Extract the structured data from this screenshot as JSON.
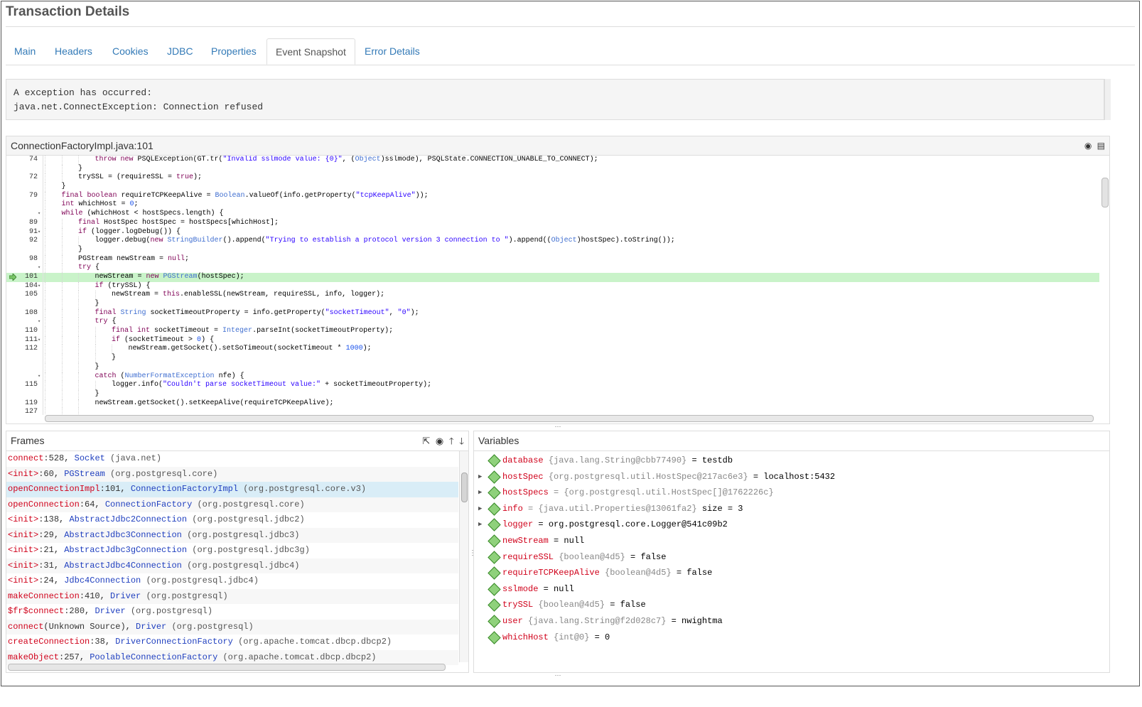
{
  "window_title": "Transaction Details",
  "tabs": [
    {
      "label": "Main"
    },
    {
      "label": "Headers"
    },
    {
      "label": "Cookies"
    },
    {
      "label": "JDBC"
    },
    {
      "label": "Properties"
    },
    {
      "label": "Event Snapshot"
    },
    {
      "label": "Error Details"
    }
  ],
  "active_tab": "Event Snapshot",
  "exception": {
    "line1": "A exception has occurred:",
    "line2": "java.net.ConnectException: Connection refused"
  },
  "code_panel": {
    "title": "ConnectionFactoryImpl.java:101",
    "lines": [
      {
        "ln": "74",
        "fold": "",
        "indent": 3,
        "html": "<span class=\"kw\">throw new</span> PSQLException(GT.tr(<span class=\"str\">\"Invalid sslmode value: {0}\"</span>, (<span class=\"typ\">Object</span>)sslmode), PSQLState.CONNECTION_UNABLE_TO_CONNECT);"
      },
      {
        "ln": "",
        "fold": "",
        "indent": 2,
        "html": "}"
      },
      {
        "ln": "72",
        "fold": "",
        "indent": 2,
        "html": "trySSL = (requireSSL = <span class=\"kw\">true</span>);"
      },
      {
        "ln": "",
        "fold": "",
        "indent": 1,
        "html": "}"
      },
      {
        "ln": "79",
        "fold": "",
        "indent": 1,
        "html": "<span class=\"kw\">final boolean</span> requireTCPKeepAlive = <span class=\"typ\">Boolean</span>.valueOf(info.getProperty(<span class=\"str\">\"tcpKeepAlive\"</span>));"
      },
      {
        "ln": "",
        "fold": "",
        "indent": 1,
        "html": "<span class=\"kw\">int</span> whichHost = <span class=\"num\">0</span>;"
      },
      {
        "ln": "",
        "fold": "▾",
        "indent": 1,
        "html": "<span class=\"kw\">while</span> (whichHost &lt; hostSpecs.length) {"
      },
      {
        "ln": "89",
        "fold": "",
        "indent": 2,
        "html": "<span class=\"kw\">final</span> HostSpec hostSpec = hostSpecs[whichHost];"
      },
      {
        "ln": "91",
        "fold": "▾",
        "indent": 2,
        "html": "<span class=\"kw\">if</span> (logger.logDebug()) {"
      },
      {
        "ln": "92",
        "fold": "",
        "indent": 3,
        "html": "logger.debug(<span class=\"kw\">new</span> <span class=\"typ\">StringBuilder</span>().append(<span class=\"str\">\"Trying to establish a protocol version 3 connection to \"</span>).append((<span class=\"typ\">Object</span>)hostSpec).toString());"
      },
      {
        "ln": "",
        "fold": "",
        "indent": 2,
        "html": "}"
      },
      {
        "ln": "98",
        "fold": "",
        "indent": 2,
        "html": "PGStream newStream = <span class=\"kw\">null</span>;"
      },
      {
        "ln": "",
        "fold": "▾",
        "indent": 2,
        "html": "<span class=\"kw\">try</span> {"
      },
      {
        "ln": "101",
        "fold": "",
        "indent": 3,
        "cur": true,
        "html": "newStream = <span class=\"kw\">new</span> <span class=\"typ\">PGStream</span>(hostSpec);"
      },
      {
        "ln": "104",
        "fold": "▾",
        "indent": 3,
        "html": "<span class=\"kw\">if</span> (trySSL) {"
      },
      {
        "ln": "105",
        "fold": "",
        "indent": 4,
        "html": "newStream = <span class=\"kw\">this</span>.enableSSL(newStream, requireSSL, info, logger);"
      },
      {
        "ln": "",
        "fold": "",
        "indent": 3,
        "html": "}"
      },
      {
        "ln": "108",
        "fold": "",
        "indent": 3,
        "html": "<span class=\"kw\">final</span> <span class=\"typ\">String</span> socketTimeoutProperty = info.getProperty(<span class=\"str\">\"socketTimeout\"</span>, <span class=\"str\">\"0\"</span>);"
      },
      {
        "ln": "",
        "fold": "▾",
        "indent": 3,
        "html": "<span class=\"kw\">try</span> {"
      },
      {
        "ln": "110",
        "fold": "",
        "indent": 4,
        "html": "<span class=\"kw\">final int</span> socketTimeout = <span class=\"typ\">Integer</span>.parseInt(socketTimeoutProperty);"
      },
      {
        "ln": "111",
        "fold": "▾",
        "indent": 4,
        "html": "<span class=\"kw\">if</span> (socketTimeout &gt; <span class=\"num\">0</span>) {"
      },
      {
        "ln": "112",
        "fold": "",
        "indent": 5,
        "html": "newStream.getSocket().setSoTimeout(socketTimeout * <span class=\"num\">1000</span>);"
      },
      {
        "ln": "",
        "fold": "",
        "indent": 4,
        "html": "}"
      },
      {
        "ln": "",
        "fold": "",
        "indent": 3,
        "html": "}"
      },
      {
        "ln": "",
        "fold": "▾",
        "indent": 3,
        "html": "<span class=\"kw\">catch</span> (<span class=\"typ\">NumberFormatException</span> nfe) {"
      },
      {
        "ln": "115",
        "fold": "",
        "indent": 4,
        "html": "logger.info(<span class=\"str\">\"Couldn't parse socketTimeout value:\"</span> + socketTimeoutProperty);"
      },
      {
        "ln": "",
        "fold": "",
        "indent": 3,
        "html": "}"
      },
      {
        "ln": "119",
        "fold": "",
        "indent": 3,
        "html": "newStream.getSocket().setKeepAlive(requireTCPKeepAlive);"
      },
      {
        "ln": "127",
        "fold": "",
        "indent": 3,
        "html": ""
      }
    ]
  },
  "frames_panel": {
    "title": "Frames",
    "rows": [
      {
        "method": "connect",
        "line": ":528, ",
        "cls": "Socket",
        "pkg": " (java.net)"
      },
      {
        "method": "<init>",
        "line": ":60, ",
        "cls": "PGStream",
        "pkg": " (org.postgresql.core)"
      },
      {
        "method": "openConnectionImpl",
        "line": ":101, ",
        "cls": "ConnectionFactoryImpl",
        "pkg": " (org.postgresql.core.v3)",
        "selected": true
      },
      {
        "method": "openConnection",
        "line": ":64, ",
        "cls": "ConnectionFactory",
        "pkg": " (org.postgresql.core)"
      },
      {
        "method": "<init>",
        "line": ":138, ",
        "cls": "AbstractJdbc2Connection",
        "pkg": " (org.postgresql.jdbc2)"
      },
      {
        "method": "<init>",
        "line": ":29, ",
        "cls": "AbstractJdbc3Connection",
        "pkg": " (org.postgresql.jdbc3)"
      },
      {
        "method": "<init>",
        "line": ":21, ",
        "cls": "AbstractJdbc3gConnection",
        "pkg": " (org.postgresql.jdbc3g)"
      },
      {
        "method": "<init>",
        "line": ":31, ",
        "cls": "AbstractJdbc4Connection",
        "pkg": " (org.postgresql.jdbc4)"
      },
      {
        "method": "<init>",
        "line": ":24, ",
        "cls": "Jdbc4Connection",
        "pkg": " (org.postgresql.jdbc4)"
      },
      {
        "method": "makeConnection",
        "line": ":410, ",
        "cls": "Driver",
        "pkg": " (org.postgresql)"
      },
      {
        "method": "$fr$connect",
        "line": ":280, ",
        "cls": "Driver",
        "pkg": " (org.postgresql)"
      },
      {
        "method": "connect",
        "line": "(Unknown Source), ",
        "cls": "Driver",
        "pkg": " (org.postgresql)"
      },
      {
        "method": "createConnection",
        "line": ":38, ",
        "cls": "DriverConnectionFactory",
        "pkg": " (org.apache.tomcat.dbcp.dbcp2)"
      },
      {
        "method": "makeObject",
        "line": ":257, ",
        "cls": "PoolableConnectionFactory",
        "pkg": " (org.apache.tomcat.dbcp.dbcp2)"
      }
    ]
  },
  "variables_panel": {
    "title": "Variables",
    "rows": [
      {
        "expandable": false,
        "name": "database",
        "type": " {java.lang.String@cbb77490}",
        "value": " = testdb"
      },
      {
        "expandable": true,
        "name": "hostSpec",
        "type": " {org.postgresql.util.HostSpec@217ac6e3}",
        "value": " = localhost:5432"
      },
      {
        "expandable": true,
        "name": "hostSpecs",
        "type": "",
        "value": " = {org.postgresql.util.HostSpec[]@1762226c}",
        "value_grey": true
      },
      {
        "expandable": true,
        "name": "info",
        "type": " = {java.util.Properties@13061fa2}",
        "value": " size = 3"
      },
      {
        "expandable": true,
        "name": "logger",
        "type": "",
        "value": " = org.postgresql.core.Logger@541c09b2",
        "name_grey": true
      },
      {
        "expandable": false,
        "name": "newStream",
        "type": "",
        "value": " = null"
      },
      {
        "expandable": false,
        "name": "requireSSL",
        "type": " {boolean@4d5}",
        "value": " = false"
      },
      {
        "expandable": false,
        "name": "requireTCPKeepAlive",
        "type": " {boolean@4d5}",
        "value": " = false"
      },
      {
        "expandable": false,
        "name": "sslmode",
        "type": "",
        "value": " = null"
      },
      {
        "expandable": false,
        "name": "trySSL",
        "type": " {boolean@4d5}",
        "value": " = false"
      },
      {
        "expandable": false,
        "name": "user",
        "type": " {java.lang.String@f2d028c7}",
        "value": " = nwightma"
      },
      {
        "expandable": false,
        "name": "whichHost",
        "type": " {int@0}",
        "value": " = 0"
      }
    ]
  },
  "icons": {
    "code_header": [
      "target-icon",
      "list-icon"
    ],
    "frames_header": [
      "external-link-icon",
      "target-icon",
      "arrow-up-icon",
      "arrow-down-icon"
    ],
    "current_line": "current-line-arrow-icon",
    "variable": "variable-diamond-icon"
  }
}
